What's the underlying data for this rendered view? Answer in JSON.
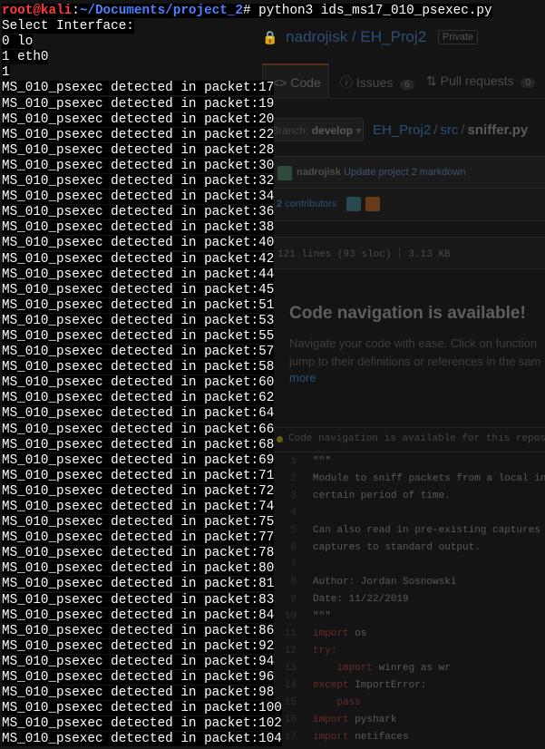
{
  "terminal": {
    "prompt_user_host": "root@kali",
    "prompt_colon": ":",
    "prompt_path": "~/Documents/project_2",
    "prompt_hash": "# ",
    "command": "python3 ids_ms17_010_psexec.py",
    "lines": [
      "Select Interface:",
      "0 lo",
      "1 eth0",
      "1",
      "MS_010_psexec detected in packet:17",
      "MS_010_psexec detected in packet:19",
      "MS_010_psexec detected in packet:20",
      "MS_010_psexec detected in packet:22",
      "MS_010_psexec detected in packet:28",
      "MS_010_psexec detected in packet:30",
      "MS_010_psexec detected in packet:32",
      "MS_010_psexec detected in packet:34",
      "MS_010_psexec detected in packet:36",
      "MS_010_psexec detected in packet:38",
      "MS_010_psexec detected in packet:40",
      "MS_010_psexec detected in packet:42",
      "MS_010_psexec detected in packet:44",
      "MS_010_psexec detected in packet:45",
      "MS_010_psexec detected in packet:51",
      "MS_010_psexec detected in packet:53",
      "MS_010_psexec detected in packet:55",
      "MS_010_psexec detected in packet:57",
      "MS_010_psexec detected in packet:58",
      "MS_010_psexec detected in packet:60",
      "MS_010_psexec detected in packet:62",
      "MS_010_psexec detected in packet:64",
      "MS_010_psexec detected in packet:66",
      "MS_010_psexec detected in packet:68",
      "MS_010_psexec detected in packet:69",
      "MS_010_psexec detected in packet:71",
      "MS_010_psexec detected in packet:72",
      "MS_010_psexec detected in packet:74",
      "MS_010_psexec detected in packet:75",
      "MS_010_psexec detected in packet:77",
      "MS_010_psexec detected in packet:78",
      "MS_010_psexec detected in packet:80",
      "MS_010_psexec detected in packet:81",
      "MS_010_psexec detected in packet:83",
      "MS_010_psexec detected in packet:84",
      "MS_010_psexec detected in packet:86",
      "MS_010_psexec detected in packet:92",
      "MS_010_psexec detected in packet:94",
      "MS_010_psexec detected in packet:96",
      "MS_010_psexec detected in packet:98",
      "MS_010_psexec detected in packet:100",
      "MS_010_psexec detected in packet:102",
      "MS_010_psexec detected in packet:104"
    ]
  },
  "github": {
    "repo_owner": "nadrojisk",
    "repo_sep": " / ",
    "repo_name": "EH_Proj2",
    "private_badge": "Private",
    "tabs": [
      {
        "label": "Code",
        "count": ""
      },
      {
        "label": "Issues",
        "count": "6"
      },
      {
        "label": "Pull requests",
        "count": "0"
      }
    ],
    "branch_prefix": "Branch: ",
    "branch_name": "develop",
    "breadcrumb": [
      "EH_Proj2",
      "src",
      "sniffer.py"
    ],
    "commit_author": "nadrojisk",
    "commit_message": "Update project 2 markdown",
    "contributors_count": "2",
    "contributors_label": "contributors",
    "file_lines": "121 lines (93 sloc)",
    "file_size": "3.13 KB",
    "nav_title": "Code navigation is available!",
    "nav_body_1": "Navigate your code with ease. Click on function",
    "nav_body_2": "jump to their definitions or references in the sam",
    "nav_more": "more",
    "code_notice": "Code navigation is available for this reposi",
    "code_lines": [
      {
        "n": "1",
        "t": "\"\"\""
      },
      {
        "n": "2",
        "t": "Module to sniff packets from a local in"
      },
      {
        "n": "3",
        "t": "certain period of time."
      },
      {
        "n": "4",
        "t": ""
      },
      {
        "n": "5",
        "t": "Can also read in pre-existing captures a"
      },
      {
        "n": "6",
        "t": "captures to standard output."
      },
      {
        "n": "7",
        "t": ""
      },
      {
        "n": "8",
        "t": "Author: Jordan Sosnowski"
      },
      {
        "n": "9",
        "t": "Date: 11/22/2019"
      },
      {
        "n": "10",
        "t": "\"\"\""
      },
      {
        "n": "11",
        "t": "import os"
      },
      {
        "n": "12",
        "t": "try:"
      },
      {
        "n": "13",
        "t": "    import winreg as wr"
      },
      {
        "n": "14",
        "t": "except ImportError:"
      },
      {
        "n": "15",
        "t": "    pass"
      },
      {
        "n": "16",
        "t": "import pyshark"
      },
      {
        "n": "17",
        "t": "import netifaces"
      }
    ]
  },
  "colors": {
    "terminal_bg": "#000000",
    "terminal_fg": "#ffffff",
    "prompt_user": "#ff3b3b",
    "prompt_path": "#4f7fff"
  }
}
